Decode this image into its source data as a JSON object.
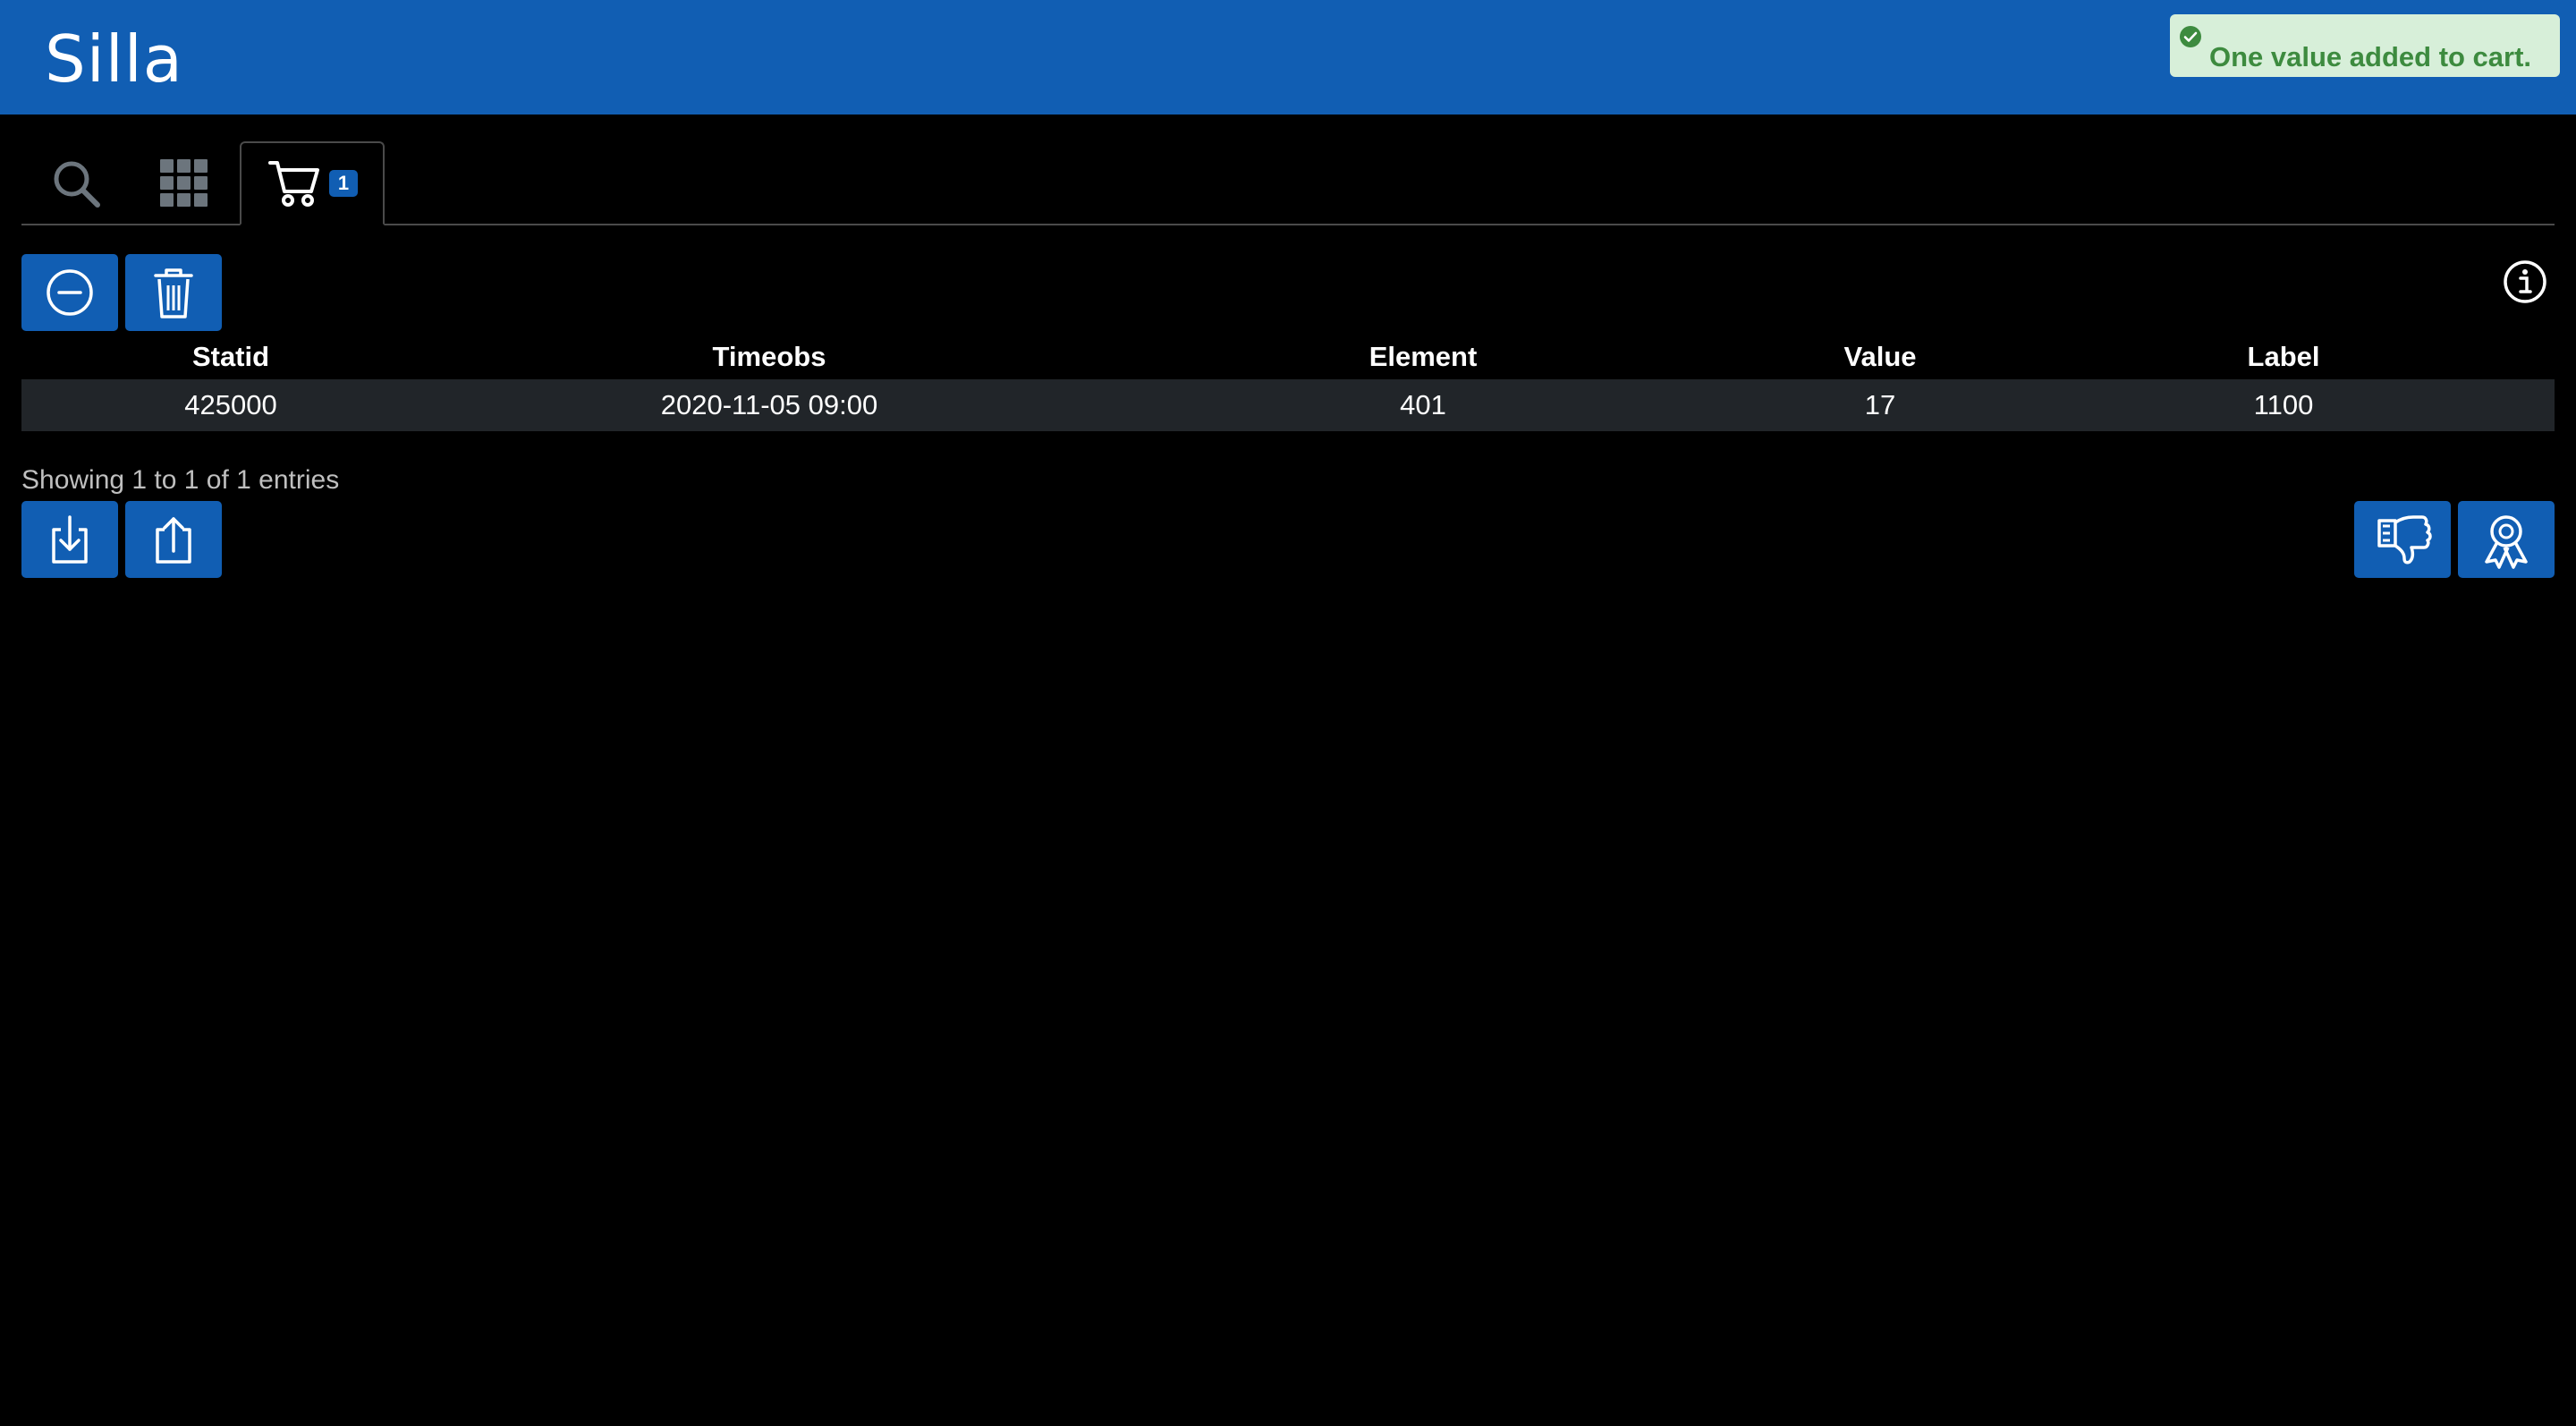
{
  "app": {
    "brand": "Silla"
  },
  "toast": {
    "message": "One value added to cart.",
    "status_color": "#3d8b3f"
  },
  "tabs": [
    {
      "name": "search",
      "icon": "search-icon",
      "active": false
    },
    {
      "name": "grid",
      "icon": "grid-icon",
      "active": false
    },
    {
      "name": "cart",
      "icon": "cart-icon",
      "active": true,
      "badge": "1"
    }
  ],
  "toolbar": {
    "remove_icon": "minus-circle-icon",
    "delete_icon": "trash-icon",
    "info_icon": "info-icon"
  },
  "table": {
    "columns": [
      "Statid",
      "Timeobs",
      "Element",
      "Value",
      "Label"
    ],
    "rows": [
      [
        "425000",
        "2020-11-05 09:00",
        "401",
        "17",
        "1100"
      ]
    ]
  },
  "footer": {
    "info": "Showing 1 to 1 of 1 entries",
    "download_icon": "download-icon",
    "upload_icon": "upload-icon",
    "reject_icon": "thumbs-down-icon",
    "approve_icon": "award-icon"
  },
  "colors": {
    "accent": "#115eb3",
    "background": "#000000",
    "row_background": "#212529"
  }
}
